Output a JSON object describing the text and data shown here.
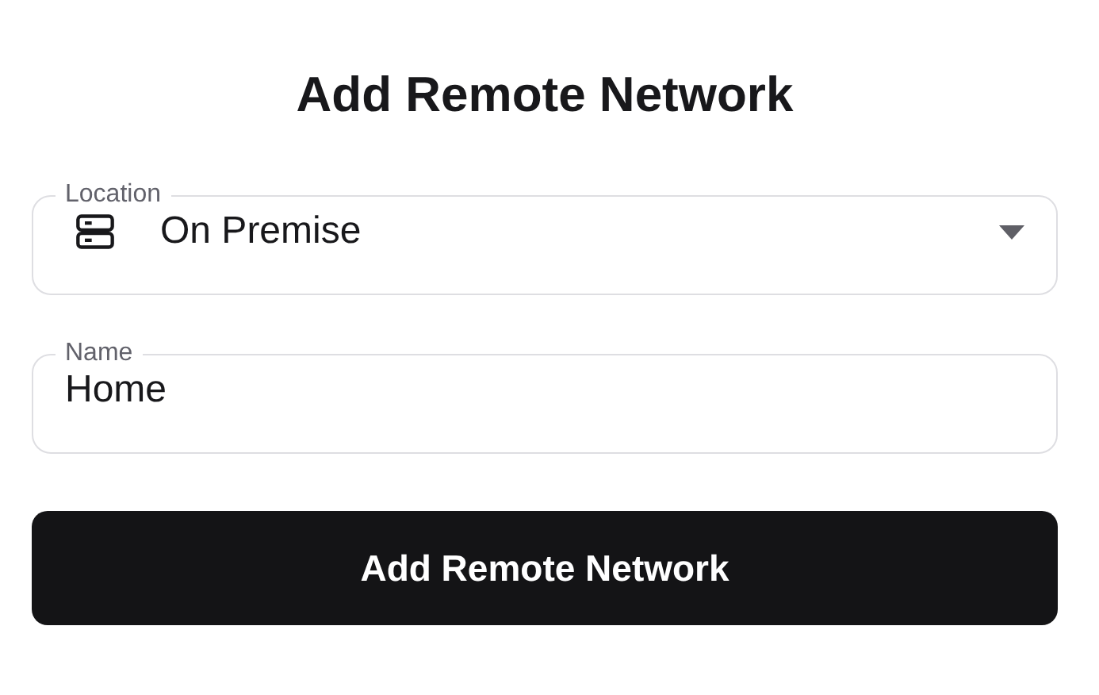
{
  "title": "Add Remote Network",
  "location": {
    "label": "Location",
    "value": "On Premise"
  },
  "name": {
    "label": "Name",
    "value": "Home"
  },
  "submit": {
    "label": "Add Remote Network"
  }
}
